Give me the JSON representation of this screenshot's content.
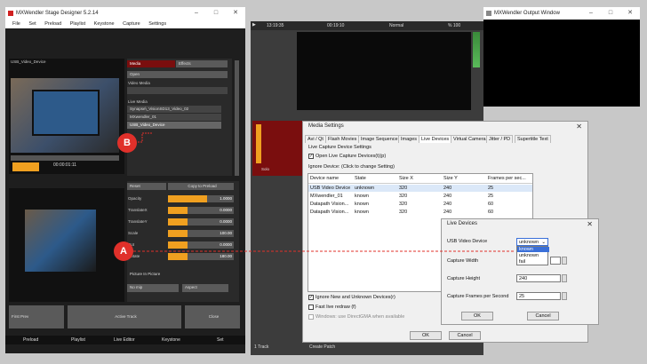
{
  "main_window": {
    "title": "MXWendler Stage Designer 5.2.14",
    "menu": [
      "File",
      "Set",
      "Preload",
      "Playlist",
      "Keystone",
      "Capture",
      "Settings"
    ],
    "preview_label": "USB_Video_Device",
    "time_display": "00:00:01:11",
    "media_tabs": [
      "Media",
      "Effects"
    ],
    "open_button": "Open",
    "video_media_label": "Video Media",
    "live_media_label": "Live Media",
    "live_media_items": [
      "Synapse\\_VisionSD13_Video_02",
      "MXwendler_01",
      "USB_Video_Device"
    ],
    "reset_label": "Reset",
    "copy_to_preload": "Copy to Preload",
    "sliders": [
      {
        "label": "Opacity",
        "value": "1.0000",
        "fill": 0.6
      },
      {
        "label": "TranslateX",
        "value": "0.0000",
        "fill": 0.3
      },
      {
        "label": "TranslateY",
        "value": "0.0000",
        "fill": 0.3
      },
      {
        "label": "Scale",
        "value": "100.00",
        "fill": 0.3
      },
      {
        "label": "Rot",
        "value": "0.0000",
        "fill": 0.3
      },
      {
        "label": "Rotate",
        "value": "180.00",
        "fill": 0.3
      }
    ],
    "picture_in_picture": "Picture In Picture",
    "no_mip": "No mip",
    "aspect": "Aspect",
    "first_prev": "First Prev",
    "active_track": "Active Track",
    "close": "Close",
    "bottom_tabs": [
      "Preload",
      "Playlist",
      "Live Editor",
      "Keystone",
      "Set"
    ]
  },
  "transport": {
    "time_left": "13:19:35",
    "time_mid": "00:19:10",
    "speed": "Normal",
    "percent": "% 100"
  },
  "output_window": {
    "title": "MXWendler Output Window"
  },
  "right_bottom": {
    "track": "1 Track",
    "create_patch": "Create Patch",
    "solo": "Solo"
  },
  "media_settings": {
    "title": "Media Settings",
    "tabs": [
      "Avi / Qt",
      "Flash Movies",
      "Image Sequence",
      "Images",
      "Live Devices",
      "Virtual Camera",
      "Jitter / PD",
      "Supertitle Text"
    ],
    "active_tab": "Live Devices",
    "section_title": "Live Capture Device Settings",
    "open_devices": "Open Live Capture Devices(t)(p)",
    "ignore_label": "Ignore Device: (Click to change Setting)",
    "columns": [
      "Device name",
      "State",
      "Size X",
      "Size Y",
      "Frames per sec..."
    ],
    "rows": [
      [
        "USB Video Device",
        "unknown",
        "320",
        "240",
        "25"
      ],
      [
        "MXwendler_01",
        "known",
        "320",
        "240",
        "25"
      ],
      [
        "Datapath Vision...",
        "known",
        "320",
        "240",
        "60"
      ],
      [
        "Datapath Vision...",
        "known",
        "320",
        "240",
        "60"
      ]
    ],
    "ignore_new": "Ignore New and Unknown Devices(r)",
    "fast_redraw": "Fast live redraw (f)",
    "windows_direct": "Windows: use DirectGMA when available",
    "ok": "OK",
    "cancel": "Cancel"
  },
  "live_devices": {
    "title": "Live Devices",
    "device_label": "USB Video Device",
    "selected": "unknown",
    "dropdown_options": [
      "known",
      "unknown",
      "fail"
    ],
    "capture_width_label": "Capture Width",
    "capture_height_label": "Capture Height",
    "capture_height": "240",
    "capture_fps_label": "Capture Frames per Second",
    "capture_fps": "25",
    "ok": "OK",
    "cancel": "Cancel"
  },
  "callouts": {
    "a": "A",
    "b": "B"
  },
  "colors": {
    "accent_orange": "#f0a020",
    "callout_red": "#e0302a",
    "dark_bg": "#1e1e1e"
  }
}
